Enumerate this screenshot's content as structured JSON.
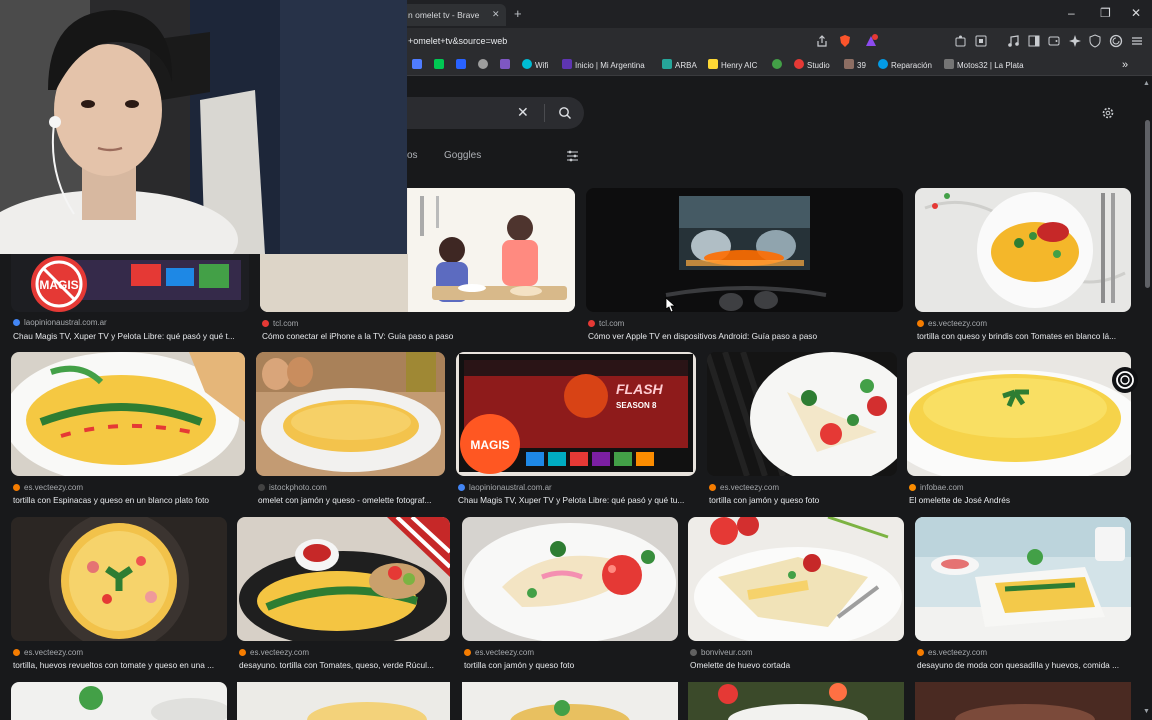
{
  "tab": {
    "title": "n omelet tv - Brave"
  },
  "address": {
    "url": "+omelet+tv&source=web"
  },
  "bookmarks": [
    {
      "label": "",
      "color": "#4f7cff"
    },
    {
      "label": "",
      "color": "#00c853"
    },
    {
      "label": "",
      "color": "#2962ff"
    },
    {
      "label": "",
      "color": "#9e9e9e"
    },
    {
      "label": "",
      "color": "#7e57c2"
    },
    {
      "label": "Wifi",
      "color": "#00bcd4"
    },
    {
      "label": "Inicio | Mi Argentina",
      "color": "#5e35b1"
    },
    {
      "label": "ARBA",
      "color": "#26a69a"
    },
    {
      "label": "Henry AIC",
      "color": "#fdd835"
    },
    {
      "label": "",
      "color": "#43a047"
    },
    {
      "label": "Studio",
      "color": "#e53935"
    },
    {
      "label": "39",
      "color": "#8d6e63"
    },
    {
      "label": "Reparación",
      "color": "#039be5"
    },
    {
      "label": "Motos32 | La Plata",
      "color": "#757575"
    }
  ],
  "filters": {
    "partial": "os",
    "goggles": "Goggles"
  },
  "results": [
    {
      "source": "laopinionaustral.com.ar",
      "title": "Chau Magis TV, Xuper TV y Pelota Libre: qué pasó y qué t...",
      "dot": "#4285f4"
    },
    {
      "source": "tcl.com",
      "title": "Cómo conectar el iPhone a la TV: Guía paso a paso",
      "dot": "#e53935"
    },
    {
      "source": "tcl.com",
      "title": "Cómo ver Apple TV en dispositivos Android: Guía paso a paso",
      "dot": "#e53935"
    },
    {
      "source": "es.vecteezy.com",
      "title": "tortilla con queso y brindis con Tomates en blanco lá...",
      "dot": "#f57c00"
    },
    {
      "source": "es.vecteezy.com",
      "title": "tortilla con Espinacas y queso en un blanco plato foto",
      "dot": "#f57c00"
    },
    {
      "source": "istockphoto.com",
      "title": "omelet con jamón y queso - omelette fotograf...",
      "dot": "#424242"
    },
    {
      "source": "laopinionaustral.com.ar",
      "title": "Chau Magis TV, Xuper TV y Pelota Libre: qué pasó y qué tu...",
      "dot": "#4285f4"
    },
    {
      "source": "es.vecteezy.com",
      "title": "tortilla con jamón y queso foto",
      "dot": "#f57c00"
    },
    {
      "source": "infobae.com",
      "title": "El omelette de José Andrés",
      "dot": "#fb8c00"
    },
    {
      "source": "es.vecteezy.com",
      "title": "tortilla, huevos revueltos con tomate y queso en una ...",
      "dot": "#f57c00"
    },
    {
      "source": "es.vecteezy.com",
      "title": "desayuno. tortilla con Tomates, queso, verde Rúcul...",
      "dot": "#f57c00"
    },
    {
      "source": "es.vecteezy.com",
      "title": "tortilla con jamón y queso foto",
      "dot": "#f57c00"
    },
    {
      "source": "bonviveur.com",
      "title": "Omelette de huevo cortada",
      "dot": "#616161"
    },
    {
      "source": "es.vecteezy.com",
      "title": "desayuno de moda con quesadilla y huevos, comida ...",
      "dot": "#f57c00"
    }
  ],
  "magis_logo": "MAGIS",
  "tv_show": {
    "title": "FLASH",
    "season": "SEASON 8"
  }
}
